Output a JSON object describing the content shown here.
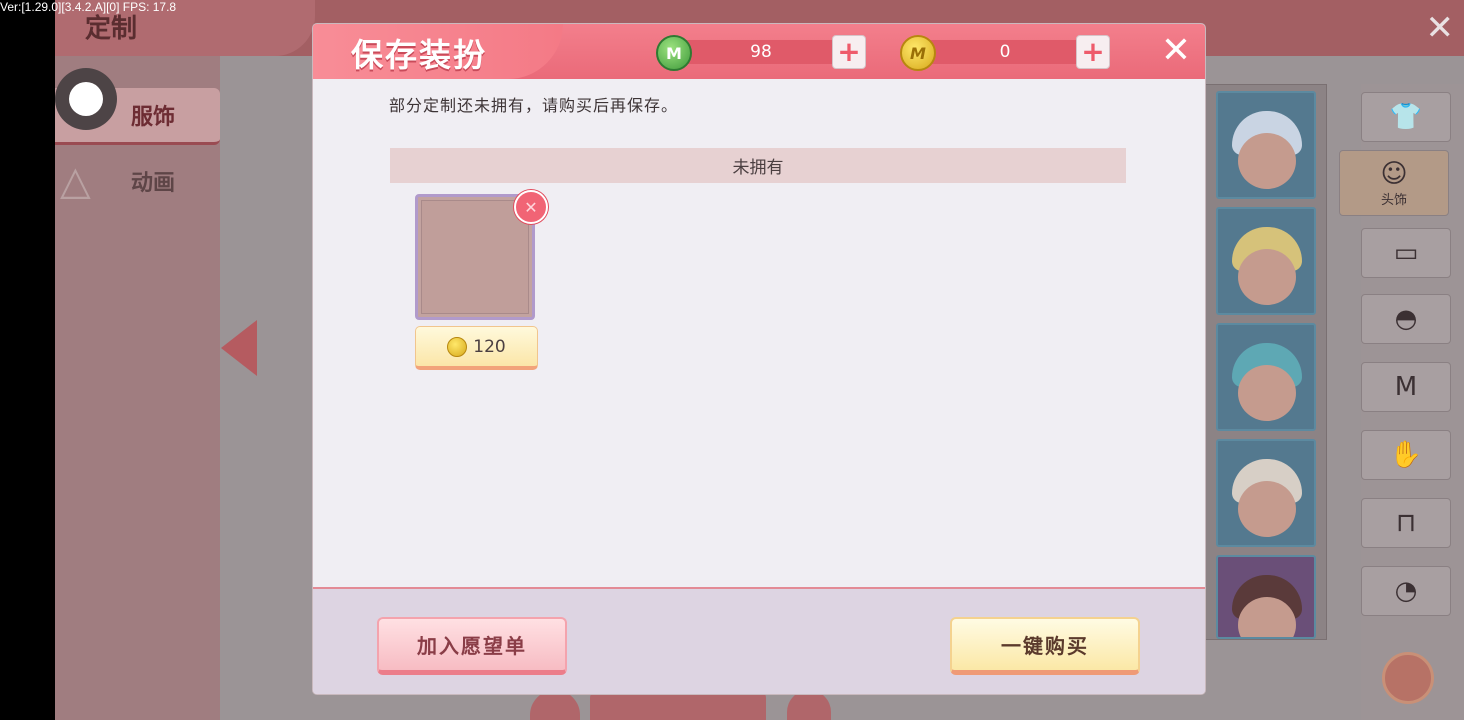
{
  "debug": {
    "fps_text": "Ver:[1.29.0][3.4.2.A][0] FPS: 17.8"
  },
  "background": {
    "screen_title": "定制",
    "close_glyph": "✕",
    "tabs": [
      {
        "label": "服饰",
        "active": true
      },
      {
        "label": "动画",
        "active": false
      }
    ],
    "category_menu": [
      {
        "icon": "shirt-icon",
        "glyph": "👕"
      },
      {
        "icon": "head-icon",
        "glyph": "☺",
        "label": "头饰",
        "active": true
      },
      {
        "icon": "face-icon",
        "glyph": "▭"
      },
      {
        "icon": "mask-icon",
        "glyph": "◓"
      },
      {
        "icon": "tshirt-icon",
        "glyph": "M"
      },
      {
        "icon": "gloves-icon",
        "glyph": "✋"
      },
      {
        "icon": "pants-icon",
        "glyph": "⊓"
      },
      {
        "icon": "shoes-icon",
        "glyph": "◔"
      }
    ]
  },
  "dialog": {
    "title": "保存装扮",
    "currencies": {
      "gem": {
        "value": "98",
        "icon_text": "M"
      },
      "coin": {
        "value": "0",
        "icon_text": "M"
      }
    },
    "plus_glyph": "+",
    "close_glyph": "✕",
    "notice": "部分定制还未拥有，请购买后再保存。",
    "section_header": "未拥有",
    "items": [
      {
        "price": "120",
        "remove_glyph": "✕"
      }
    ],
    "buttons": {
      "wishlist": "加入愿望单",
      "buy_all": "一键购买"
    }
  },
  "colors": {
    "header_pink": "#ee6e7c",
    "coin_gold": "#e3b52a",
    "gem_green": "#4fae46"
  }
}
